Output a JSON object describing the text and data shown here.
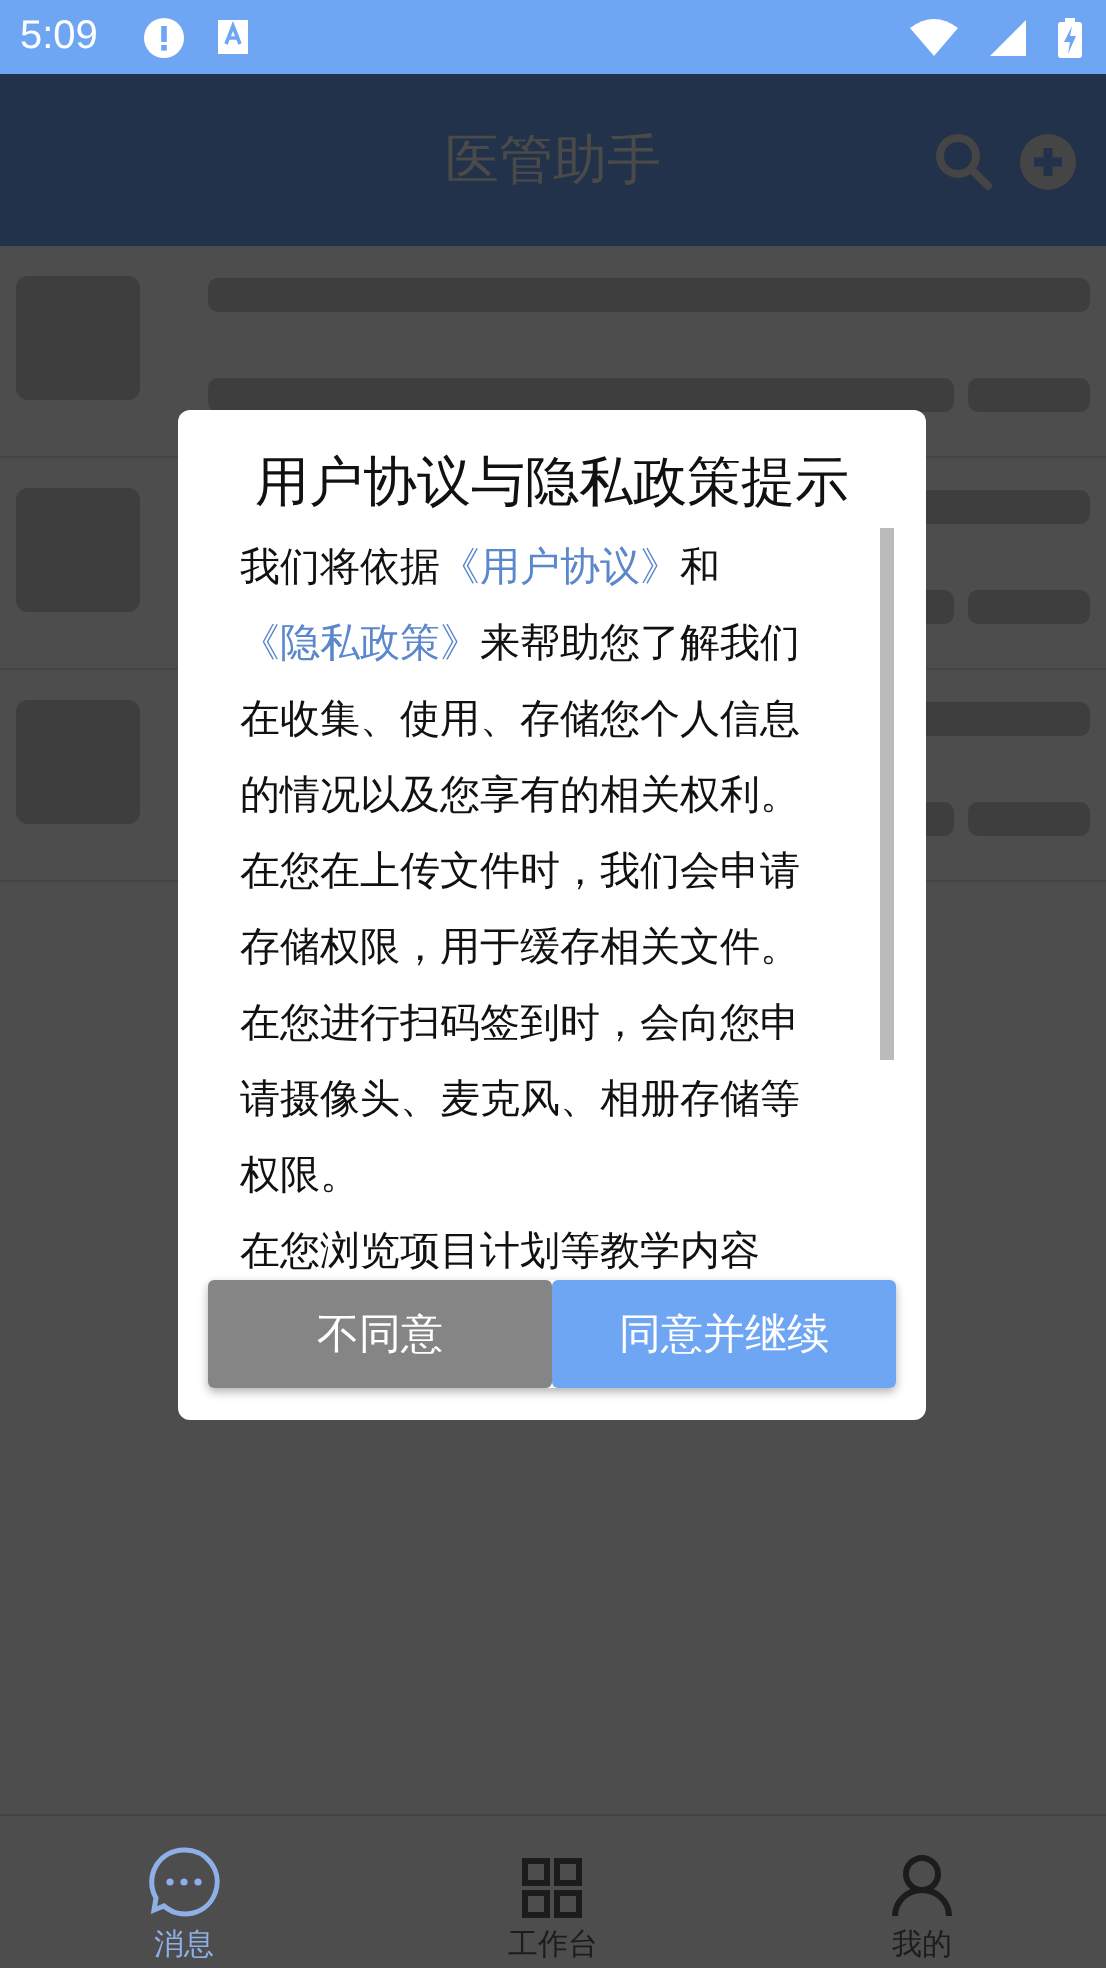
{
  "status_bar": {
    "time": "5:09"
  },
  "header": {
    "title": "医管助手"
  },
  "list": [
    {
      "kind": "placeholder"
    },
    {
      "kind": "placeholder"
    },
    {
      "kind": "placeholder"
    }
  ],
  "dialog": {
    "title": "用户协议与隐私政策提示",
    "paragraphs": [
      {
        "segments": [
          {
            "kind": "text",
            "text": "我们将依据"
          },
          {
            "kind": "link",
            "text": "《用户协议》"
          },
          {
            "kind": "text",
            "text": "和"
          },
          {
            "kind": "link",
            "text": "《隐私政策》"
          },
          {
            "kind": "text",
            "text": "来帮助您了解我们在收集、使用、存储您个人信息的情况以及您享有的相关权利。"
          }
        ]
      },
      {
        "segments": [
          {
            "kind": "text",
            "text": "在您在上传文件时，我们会申请存储权限，用于缓存相关文件。"
          }
        ]
      },
      {
        "segments": [
          {
            "kind": "text",
            "text": "在您进行扫码签到时，会向您申请摄像头、麦克风、相册存储等权限。"
          }
        ]
      },
      {
        "segments": [
          {
            "kind": "text",
            "text": "在您浏览项目计划等教学内容"
          }
        ]
      }
    ],
    "buttons": [
      {
        "kind": "decline",
        "label": "不同意"
      },
      {
        "kind": "accept",
        "label": "同意并继续"
      }
    ]
  },
  "bottom_nav": [
    {
      "label": "消息",
      "selected": true
    },
    {
      "label": "工作台",
      "selected": false
    },
    {
      "label": "我的",
      "selected": false
    }
  ]
}
